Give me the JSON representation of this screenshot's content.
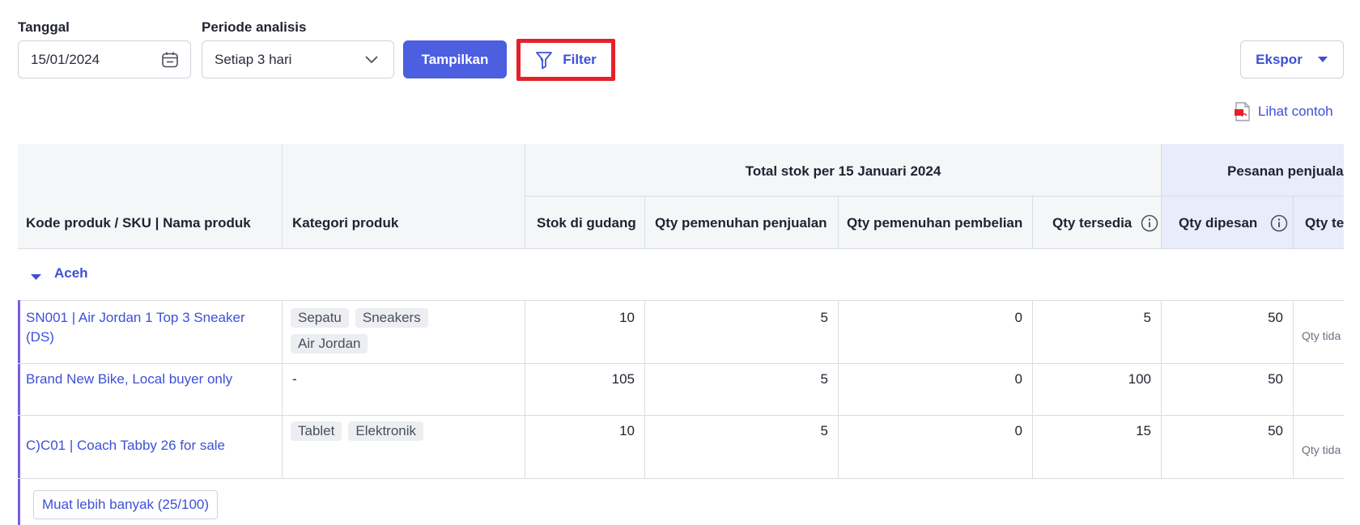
{
  "controls": {
    "date_label": "Tanggal",
    "date_value": "15/01/2024",
    "period_label": "Periode analisis",
    "period_value": "Setiap 3 hari",
    "show_button": "Tampilkan",
    "filter_button": "Filter",
    "export_button": "Ekspor",
    "sample_link": "Lihat contoh"
  },
  "table": {
    "col_product": "Kode produk / SKU | Nama produk",
    "col_category": "Kategori produk",
    "group_total": "Total stok per 15 Januari 2024",
    "group_sales": "Pesanan penjualan",
    "col_stock": "Stok di gudang",
    "col_sales_fulfil": "Qty pemenuhan penjualan",
    "col_purchase_fulfil": "Qty pemenuhan pembelian",
    "col_available": "Qty tersedia",
    "col_ordered": "Qty dipesan",
    "col_next": "Qty te",
    "region": "Aceh",
    "rows": [
      {
        "name_line1": "SN001 | Air Jordan 1 Top 3 Sneaker",
        "name_line2": "(DS)",
        "tags": [
          "Sepatu",
          "Sneakers",
          "Air Jordan"
        ],
        "stock": "10",
        "sales_fulfil": "5",
        "purchase_fulfil": "0",
        "available": "5",
        "ordered": "50",
        "note": "Qty tida"
      },
      {
        "name_line1": "Brand New Bike, Local buyer only",
        "name_line2": "",
        "category_text": "-",
        "stock": "105",
        "sales_fulfil": "5",
        "purchase_fulfil": "0",
        "available": "100",
        "ordered": "50",
        "note": ""
      },
      {
        "name_line1": "C)C01 | Coach Tabby 26 for sale",
        "name_line2": "",
        "tags": [
          "Tablet",
          "Elektronik"
        ],
        "stock": "10",
        "sales_fulfil": "5",
        "purchase_fulfil": "0",
        "available": "15",
        "ordered": "50",
        "note": "Qty tida"
      }
    ],
    "load_more": "Muat lebih banyak (25/100)"
  }
}
